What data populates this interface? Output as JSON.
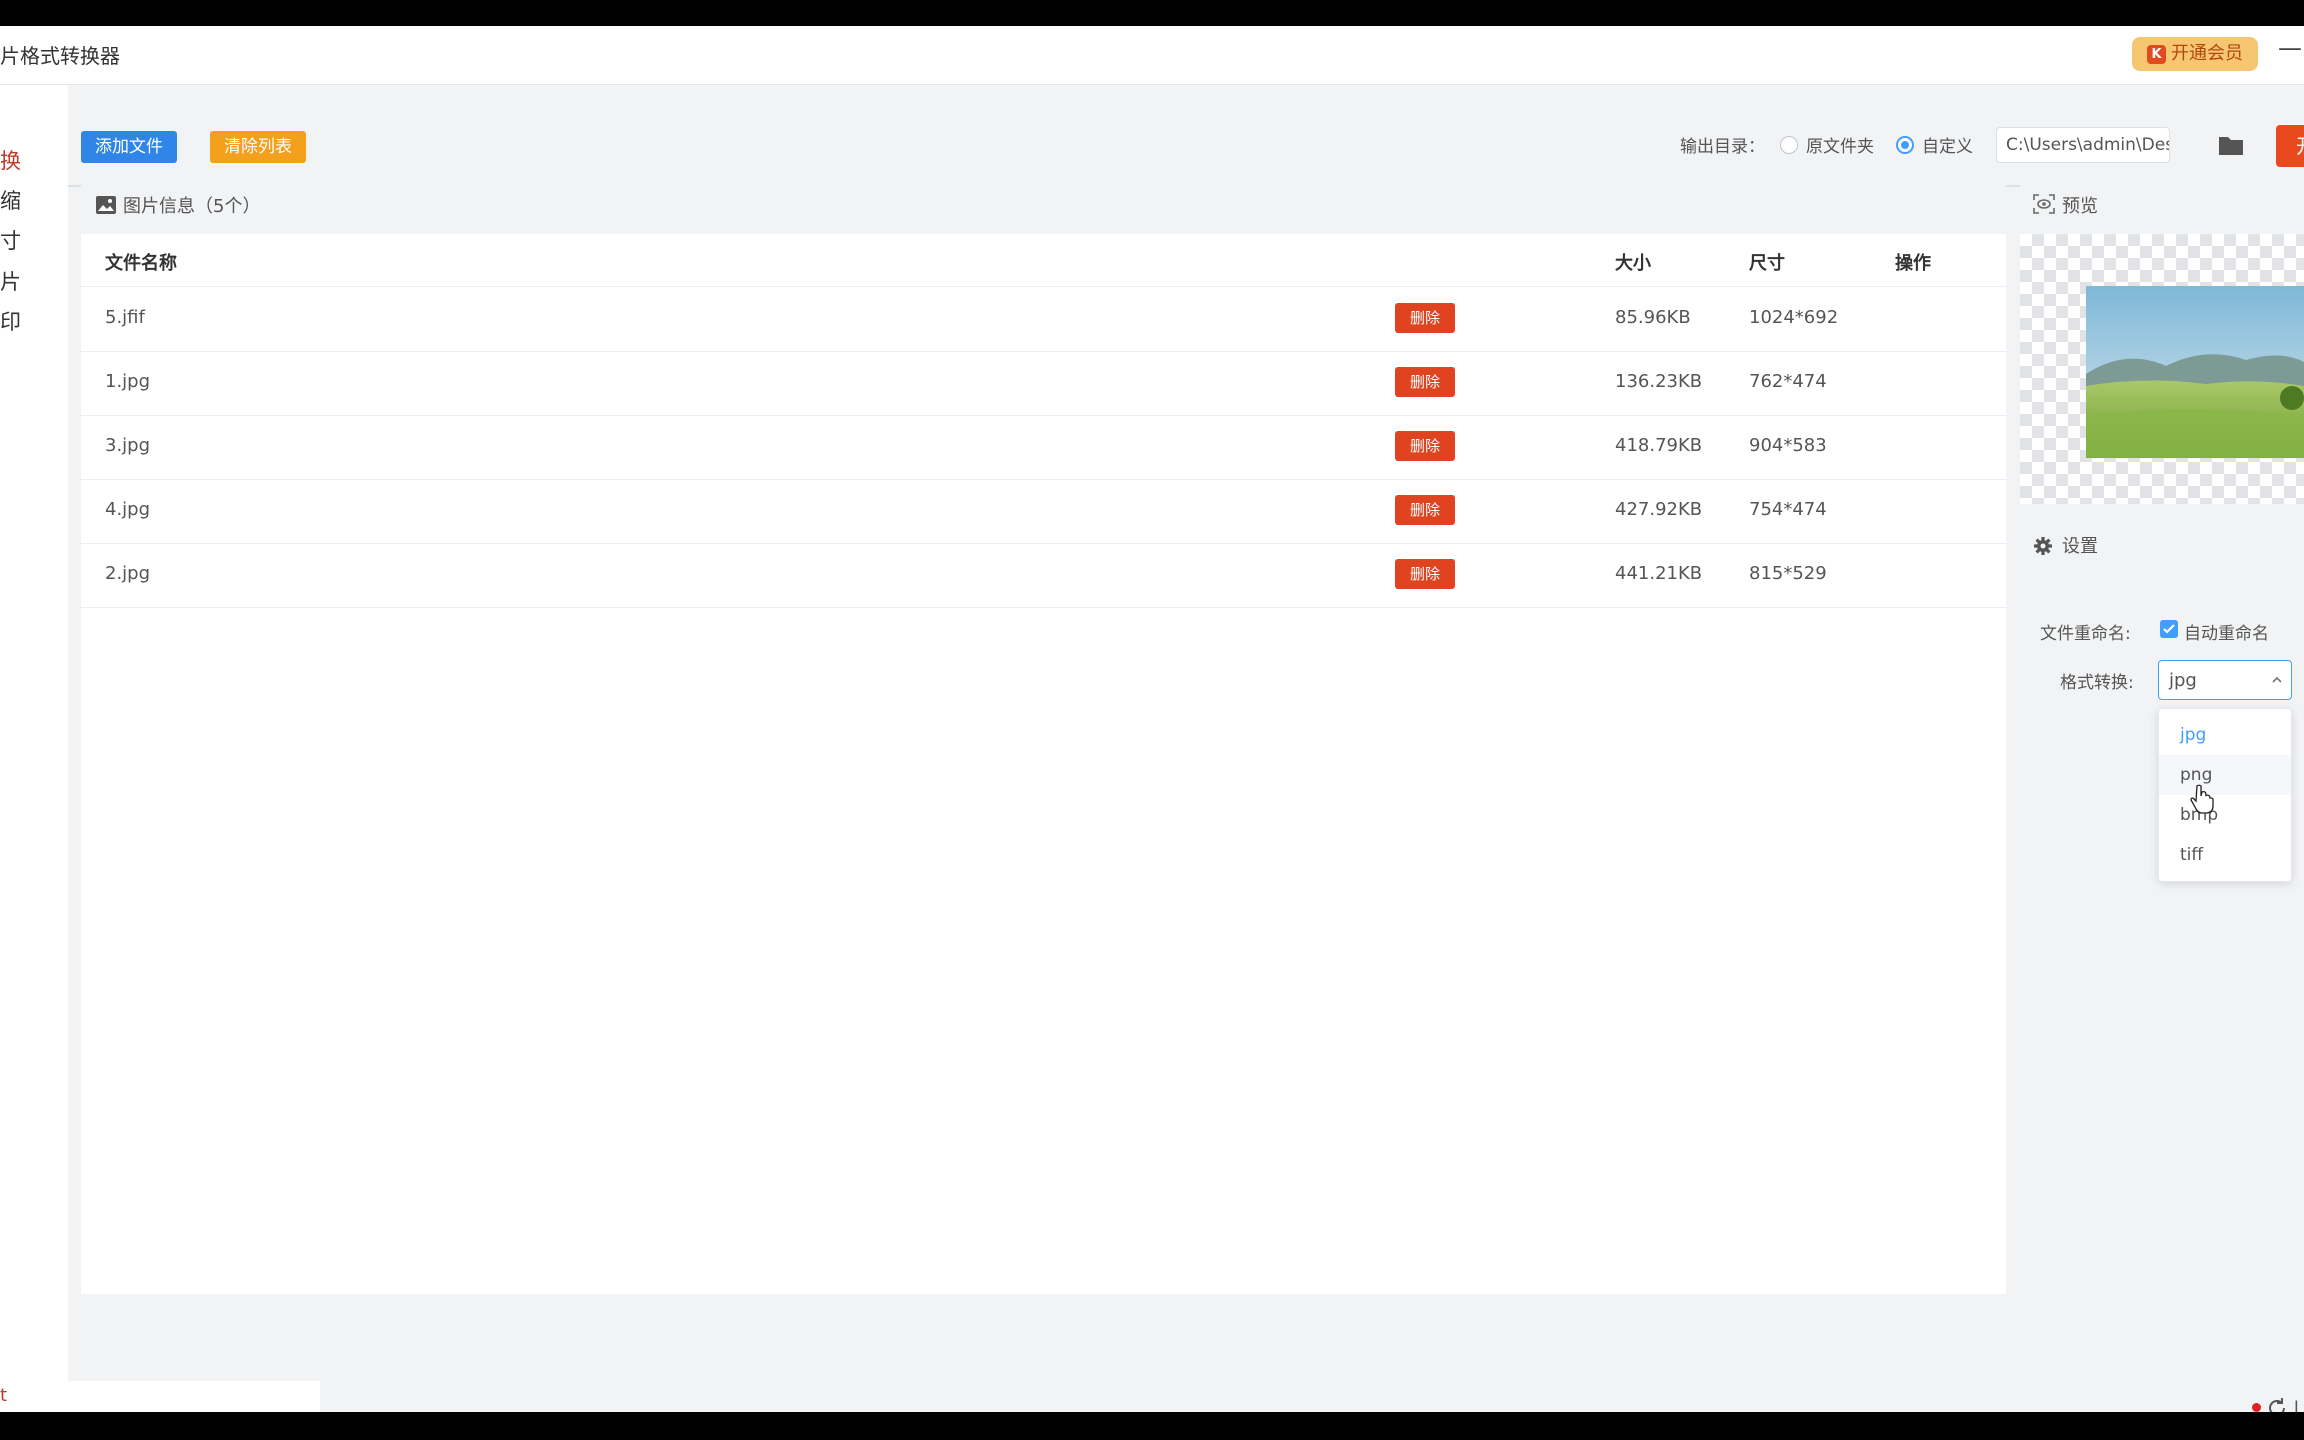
{
  "app": {
    "title": "图片格式转换器",
    "title_visible": "片格式转换器",
    "vip_label": "开通会员",
    "minimize": "—"
  },
  "sidebar": {
    "items": [
      {
        "label": "转换",
        "visible": "换",
        "active": true
      },
      {
        "label": "压缩",
        "visible": "缩",
        "active": false
      },
      {
        "label": "尺寸",
        "visible": "寸",
        "active": false
      },
      {
        "label": "图片",
        "visible": "片",
        "active": false
      },
      {
        "label": "水印",
        "visible": "印",
        "active": false
      }
    ]
  },
  "toolbar": {
    "add_label": "添加文件",
    "clear_label": "清除列表",
    "output_dir_label": "输出目录：",
    "radio_original_label": "原文件夹",
    "radio_custom_label": "自定义",
    "output_path": "C:\\Users\\admin\\Deskto",
    "start_label": "开"
  },
  "file_panel": {
    "title": "图片信息（5个）",
    "columns": [
      "文件名称",
      "大小",
      "尺寸",
      "操作"
    ],
    "rows": [
      {
        "name": "5.jfif",
        "size": "85.96KB",
        "dims": "1024*692",
        "action": "删除"
      },
      {
        "name": "1.jpg",
        "size": "136.23KB",
        "dims": "762*474",
        "action": "删除"
      },
      {
        "name": "3.jpg",
        "size": "418.79KB",
        "dims": "904*583",
        "action": "删除"
      },
      {
        "name": "4.jpg",
        "size": "427.92KB",
        "dims": "754*474",
        "action": "删除"
      },
      {
        "name": "2.jpg",
        "size": "441.21KB",
        "dims": "815*529",
        "action": "删除"
      }
    ]
  },
  "preview": {
    "title": "预览"
  },
  "settings": {
    "title": "设置",
    "rename_label": "文件重命名:",
    "auto_rename_label": "自动重命名",
    "auto_rename_checked": true,
    "format_label": "格式转换:",
    "format_value": "jpg",
    "format_options": [
      "jpg",
      "png",
      "bmp",
      "tiff"
    ],
    "hovered_option": "png"
  },
  "statusbar": {
    "left_text": "t",
    "right_text": "I"
  },
  "colors": {
    "accent_blue": "#409eff",
    "add_button": "#2f86e8",
    "clear_button": "#f3a01d",
    "delete_button": "#e0431f",
    "vip_bg": "#f7c670",
    "active_nav": "#c0392b"
  }
}
